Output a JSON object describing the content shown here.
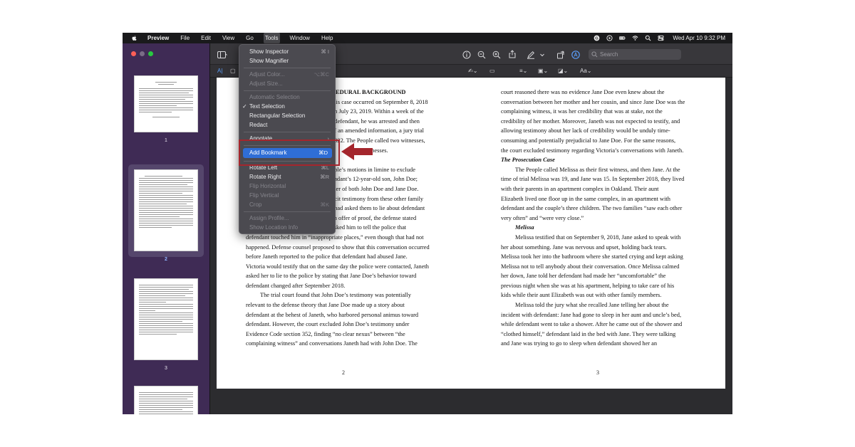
{
  "menubar": {
    "app_name": "Preview",
    "items": [
      "File",
      "Edit",
      "View",
      "Go",
      "Tools",
      "Window",
      "Help"
    ],
    "clock": "Wed Apr 10  9:32 PM"
  },
  "sidebar": {
    "pages": [
      "1",
      "2",
      "3"
    ]
  },
  "toolbar": {
    "search_placeholder": "Search",
    "text_style_label": "Aa"
  },
  "tools_menu": {
    "items": [
      {
        "label": "Show Inspector",
        "shortcut": "⌘ I",
        "enabled": true
      },
      {
        "label": "Show Magnifier",
        "shortcut": "",
        "enabled": true
      },
      {
        "label": "Adjust Color...",
        "shortcut": "⌥⌘C",
        "enabled": false
      },
      {
        "label": "Adjust Size...",
        "shortcut": "",
        "enabled": false
      },
      {
        "label": "Automatic Selection",
        "shortcut": "",
        "enabled": false
      },
      {
        "label": "Text Selection",
        "shortcut": "",
        "enabled": true,
        "checked": true
      },
      {
        "label": "Rectangular Selection",
        "shortcut": "",
        "enabled": true
      },
      {
        "label": "Redact",
        "shortcut": "",
        "enabled": true
      },
      {
        "label": "Annotate",
        "shortcut": "",
        "enabled": true
      },
      {
        "label": "Add Bookmark",
        "shortcut": "⌘D",
        "enabled": true,
        "highlighted": true
      },
      {
        "label": "Rotate Left",
        "shortcut": "⌘L",
        "enabled": true
      },
      {
        "label": "Rotate Right",
        "shortcut": "⌘R",
        "enabled": true
      },
      {
        "label": "Flip Horizontal",
        "shortcut": "",
        "enabled": false
      },
      {
        "label": "Flip Vertical",
        "shortcut": "",
        "enabled": false
      },
      {
        "label": "Crop",
        "shortcut": "⌘K",
        "enabled": false
      },
      {
        "label": "Assign Profile...",
        "shortcut": "",
        "enabled": false
      },
      {
        "label": "Show Location Info",
        "shortcut": "",
        "enabled": false
      }
    ]
  },
  "document": {
    "left_column": [
      "CEDURAL BACKGROUND",
      "this case occurred on September 8, 2018",
      "on July 23, 2019.  Within a week of the",
      "t defendant, he was arrested and then",
      "of an amended information, a jury trial",
      "2022.  The People called two witnesses,",
      "no witnesses.",
      "",
      "ople’s motions in limine to exclude",
      "endant’s 12-year-old son, John Doe;",
      "ther of both John Doe and Jane Doe.",
      "licit testimony from these other family",
      ", had asked them to lie about defendant",
      "an offer of proof, the defense stated",
      "asked him to tell the police that",
      "defendant touched him in “inappropriate places,” even though that had not",
      "happened.  Defense counsel proposed to show that this conversation occurred",
      "before Janeth reported to the police that defendant had abused Jane.",
      "Victoria would testify that on the same day the police were contacted, Janeth",
      "asked her to lie to the police by stating that Jane Doe’s behavior toward",
      "defendant changed after September 2018.",
      "The trial court found that John Doe’s testimony was potentially",
      "relevant to the defense theory that Jane Doe made up a story about",
      "defendant at the behest of Janeth, who harbored personal animus toward",
      "defendant.  However, the court excluded John Doe’s testimony under",
      "Evidence Code section 352, finding “no clear nexus” between “the",
      "complaining witness” and conversations Janeth had with John Doe.  The"
    ],
    "right_column": [
      "court reasoned there was no evidence Jane Doe even knew about the",
      "conversation between her mother and her cousin, and since Jane Doe was the",
      "complaining witness, it was her credibility that was at stake, not the",
      "credibility of her mother.  Moreover, Janeth was not expected to testify, and",
      "allowing testimony about her lack of credibility would be unduly time-",
      "consuming and potentially prejudicial to Jane Doe.  For the same reasons,",
      "the court excluded testimony regarding Victoria’s conversations with Janeth.",
      "The Prosecution Case",
      "The People called Melissa as their first witness, and then Jane.  At the",
      "time of trial Melissa was 19, and Jane was 15.  In September 2018, they lived",
      "with their parents in an apartment complex in Oakland.  Their aunt",
      "Elizabeth lived one floor up in the same complex, in an apartment with",
      "defendant and the couple’s three children.  The two families “saw each other",
      "very often” and “were very close.”",
      "Melissa",
      "Melissa testified that on September 9, 2018, Jane asked to speak with",
      "her about something.  Jane was nervous and upset, holding back tears.",
      "Melissa took her into the bathroom where she started crying and kept asking",
      "Melissa not to tell anybody about their conversation.  Once Melissa calmed",
      "her down, Jane told her defendant had made her “uncomfortable” the",
      "previous night when she was at his apartment, helping to take care of his",
      "kids while their aunt Elizabeth was out with other family members.",
      "Melissa told the jury what she recalled Jane telling her about the",
      "incident with defendant:  Jane had gone to sleep in her aunt and uncle’s bed,",
      "while defendant went to take a shower.  After he came out of the shower and",
      "“clothed himself,” defendant laid in the bed with Jane.  They were talking",
      "and Jane was trying to go to sleep when defendant showed her an"
    ],
    "left_page_number": "2",
    "right_page_number": "3"
  }
}
